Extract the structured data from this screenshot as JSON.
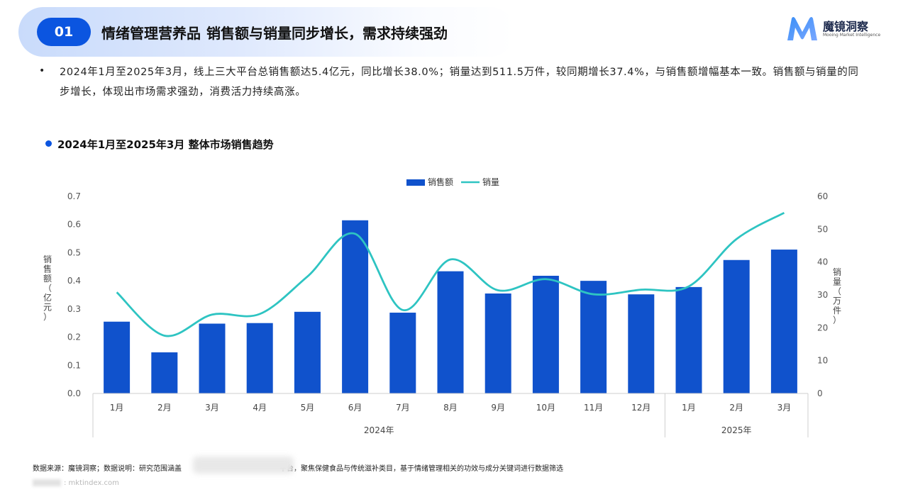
{
  "header": {
    "section_number": "01",
    "title": "情绪管理营养品",
    "subtitle": "销售额与销量同步增长，需求持续强劲"
  },
  "brand": {
    "name": "魔镜洞察",
    "tagline": "Mooing Market Intelligence",
    "colors": {
      "primary": "#0b55e0",
      "logo_gradient": [
        "#3a8ff7",
        "#7aa7ff"
      ]
    }
  },
  "summary": {
    "bullet": "•",
    "text": "2024年1月至2025年3月，线上三大平台总销售额达5.4亿元，同比增长38.0%；销量达到511.5万件，较同期增长37.4%，与销售额增幅基本一致。销售额与销量的同步增长，体现出市场需求强劲，消费活力持续高涨。"
  },
  "chart_section": {
    "title": "2024年1月至2025年3月 整体市场销售趋势"
  },
  "chart_data": {
    "type": "bar",
    "categories": [
      "1月",
      "2月",
      "3月",
      "4月",
      "5月",
      "6月",
      "7月",
      "8月",
      "9月",
      "10月",
      "11月",
      "12月",
      "1月",
      "2月",
      "3月"
    ],
    "groups": [
      {
        "label": "2024年",
        "start": 0,
        "end": 11
      },
      {
        "label": "2025年",
        "start": 12,
        "end": 14
      }
    ],
    "series": [
      {
        "name": "销售额",
        "type": "bar",
        "axis": "left",
        "color": "#1052cc",
        "values": [
          0.255,
          0.146,
          0.248,
          0.25,
          0.29,
          0.615,
          0.287,
          0.434,
          0.355,
          0.418,
          0.4,
          0.352,
          0.378,
          0.474,
          0.511
        ]
      },
      {
        "name": "销量",
        "type": "line",
        "axis": "right",
        "color": "#2ec4c2",
        "values": [
          30.8,
          17.6,
          24.0,
          24.2,
          35.6,
          48.6,
          25.4,
          40.8,
          31.4,
          34.8,
          30.2,
          31.6,
          32.6,
          47.0,
          55.0
        ]
      }
    ],
    "y_left": {
      "label": "销售额（亿元）",
      "ylim": [
        0,
        0.7
      ],
      "ticks": [
        "0.0",
        "0.1",
        "0.2",
        "0.3",
        "0.4",
        "0.5",
        "0.6",
        "0.7"
      ]
    },
    "y_right": {
      "label": "销量（万件）",
      "ylim": [
        0,
        60
      ],
      "ticks": [
        "0",
        "10",
        "20",
        "30",
        "40",
        "50",
        "60"
      ]
    },
    "legend_position": "top-center",
    "grid": false
  },
  "footnote": {
    "text_before": "数据来源：魔镜洞察；数据说明：研究范围涵盖",
    "text_after": "平台，聚焦保健食品与传统滋补类目，基于情绪管理相关的功效与成分关键词进行数据筛选"
  },
  "watermark": {
    "text": ": mktindex.com"
  }
}
